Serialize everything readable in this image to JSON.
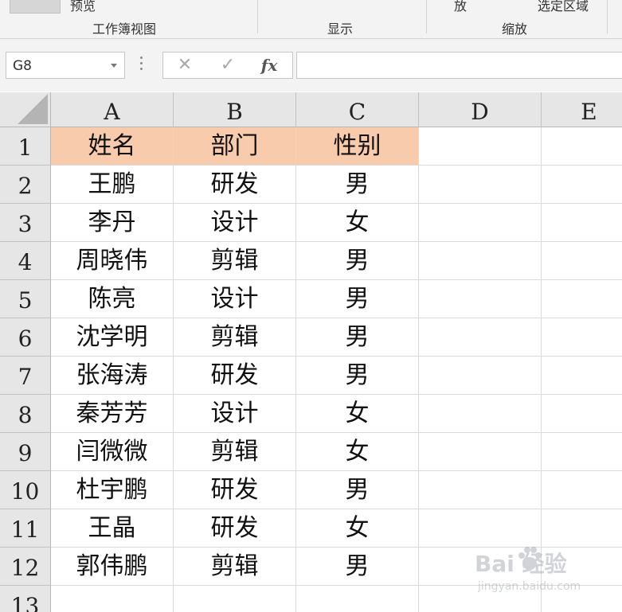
{
  "ribbon": {
    "left_button_label": "预览",
    "group_workbook_views": "工作簿视图",
    "group_show": "显示",
    "zoom_fragment_label": "放",
    "zoom_selection_label": "选定区域",
    "group_zoom": "缩放"
  },
  "formula_bar": {
    "name_box_value": "G8",
    "cancel_symbol": "✕",
    "enter_symbol": "✓",
    "function_symbol": "fx",
    "formula_value": ""
  },
  "columns": [
    "A",
    "B",
    "C",
    "D",
    "E"
  ],
  "rows": [
    "1",
    "2",
    "3",
    "4",
    "5",
    "6",
    "7",
    "8",
    "9",
    "10",
    "11",
    "12",
    "13"
  ],
  "table": {
    "header": [
      "姓名",
      "部门",
      "性别"
    ],
    "header_fill": "#f8cbad",
    "records": [
      [
        "王鹏",
        "研发",
        "男"
      ],
      [
        "李丹",
        "设计",
        "女"
      ],
      [
        "周晓伟",
        "剪辑",
        "男"
      ],
      [
        "陈亮",
        "设计",
        "男"
      ],
      [
        "沈学明",
        "剪辑",
        "男"
      ],
      [
        "张海涛",
        "研发",
        "男"
      ],
      [
        "秦芳芳",
        "设计",
        "女"
      ],
      [
        "闫微微",
        "剪辑",
        "女"
      ],
      [
        "杜宇鹏",
        "研发",
        "男"
      ],
      [
        "王晶",
        "研发",
        "女"
      ],
      [
        "郭伟鹏",
        "剪辑",
        "男"
      ]
    ]
  },
  "watermark": {
    "brand_text": "Bai 经验",
    "url_text": "jingyan.baidu.com"
  },
  "colors": {
    "header_fill": "#f8cbad",
    "gridline": "#dadada",
    "heading_bg": "#e6e6e6"
  }
}
